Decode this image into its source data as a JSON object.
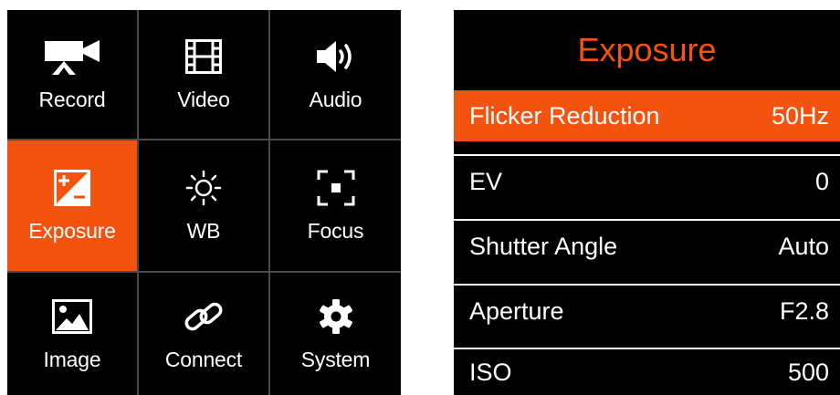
{
  "menu": {
    "tiles": [
      {
        "label": "Record",
        "icon": "video-camera-icon"
      },
      {
        "label": "Video",
        "icon": "film-icon"
      },
      {
        "label": "Audio",
        "icon": "speaker-icon"
      },
      {
        "label": "Exposure",
        "icon": "exposure-plus-minus-icon",
        "selected": true
      },
      {
        "label": "WB",
        "icon": "sun-icon"
      },
      {
        "label": "Focus",
        "icon": "focus-frame-icon"
      },
      {
        "label": "Image",
        "icon": "image-icon"
      },
      {
        "label": "Connect",
        "icon": "link-icon"
      },
      {
        "label": "System",
        "icon": "gear-icon"
      }
    ]
  },
  "panel": {
    "title": "Exposure",
    "rows": [
      {
        "label": "Flicker Reduction",
        "value": "50Hz",
        "selected": true
      },
      {
        "label": "EV",
        "value": "0"
      },
      {
        "label": "Shutter Angle",
        "value": "Auto"
      },
      {
        "label": "Aperture",
        "value": "F2.8"
      },
      {
        "label": "ISO",
        "value": "500"
      }
    ]
  },
  "colors": {
    "accent": "#f4520f",
    "background": "#000000",
    "text": "#ffffff",
    "divider": "#4a4a4a"
  }
}
